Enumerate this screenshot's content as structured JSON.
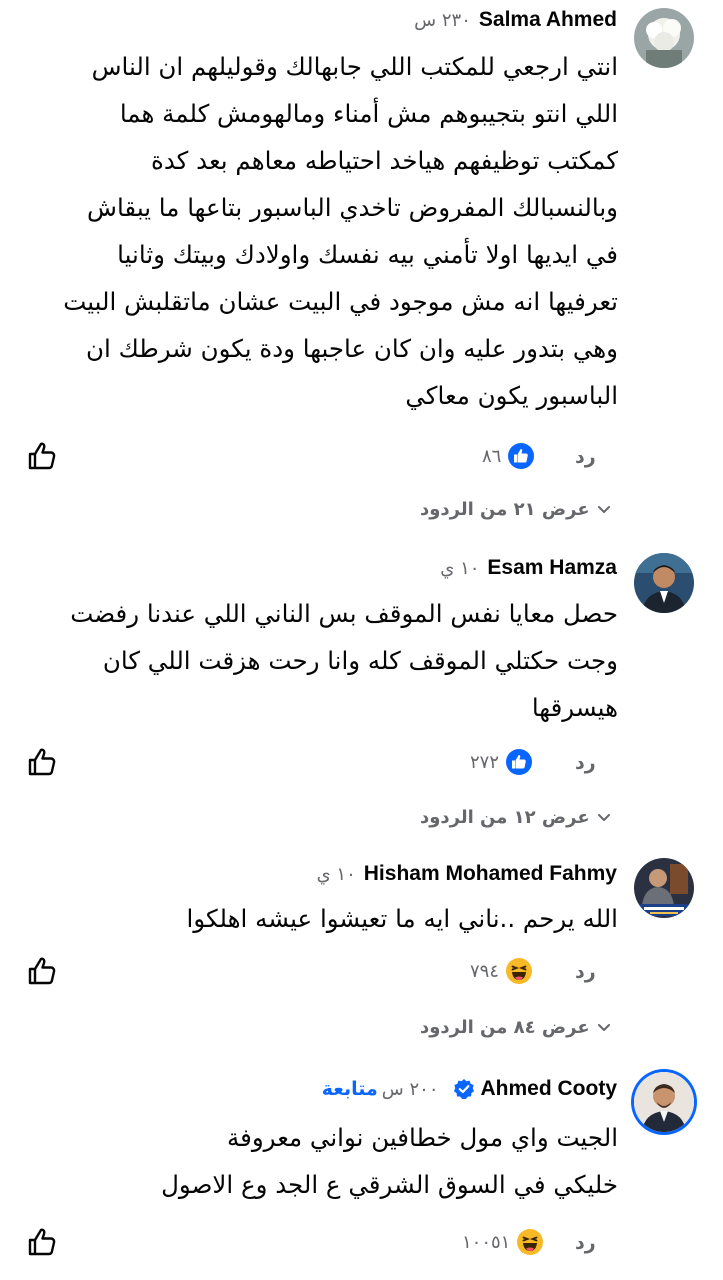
{
  "comments": [
    {
      "author": "Salma Ahmed",
      "time": "٢٣٠ س",
      "avatar": "flower-photo",
      "lines": [
        "انتي ارجعي للمكتب اللي جابهالك وقوليلهم ان الناس",
        "اللي انتو بتجيبوهم مش أمناء ومالهومش كلمة هما",
        "كمكتب توظيفهم هياخد احتياطه معاهم بعد كدة",
        "وبالنسبالك المفروض تاخدي الباسبور بتاعها ما يبقاش",
        "في ايديها اولا تأمني بيه نفسك واولادك وبيتك وثانيا",
        "تعرفيها انه مش موجود في البيت عشان ماتقلبش البيت",
        "وهي بتدور عليه وان كان عاجبها ودة يكون شرطك ان",
        "الباسبور يكون معاكي"
      ],
      "reply": "رد",
      "reaction_icon": "like-reaction-icon",
      "reaction_count": "٨٦",
      "view_replies": "عرض ٢١ من الردود"
    },
    {
      "author": "Esam Hamza",
      "time": "١٠ ي",
      "avatar": "man-suit-photo",
      "lines": [
        "حصل معايا نفس الموقف بس الناني اللي عندنا رفضت",
        "وجت حكتلي الموقف كله وانا رحت هزقت اللي كان",
        "هيسرقها"
      ],
      "reply": "رد",
      "reaction_icon": "like-reaction-icon",
      "reaction_count": "٢٧٢",
      "view_replies": "عرض ١٢ من الردود"
    },
    {
      "author": "Hisham Mohamed Fahmy",
      "time": "١٠ ي",
      "avatar": "poster-photo",
      "lines": [
        "الله يرحم ..ناني ايه ما تعيشوا عيشه اهلكوا"
      ],
      "reply": "رد",
      "reaction_icon": "haha-reaction-icon",
      "reaction_count": "٧٩٤",
      "view_replies": "عرض ٨٤ من الردود"
    },
    {
      "author": "Ahmed Cooty",
      "time": "٢٠٠ س",
      "follow": "متابعة",
      "verified": true,
      "avatar": "man-portrait-photo",
      "lines": [
        "الجيت واي مول خطافين نواني معروفة",
        "خليكي في السوق الشرقي ع الجد وع الاصول"
      ],
      "reply": "رد",
      "reaction_icon": "haha-reaction-icon",
      "reaction_count": "١٠٠٥١"
    }
  ],
  "colors": {
    "text": "#050505",
    "secondary": "#65676b",
    "like_blue": "#0866ff",
    "haha_yellow": "#f7b928"
  }
}
